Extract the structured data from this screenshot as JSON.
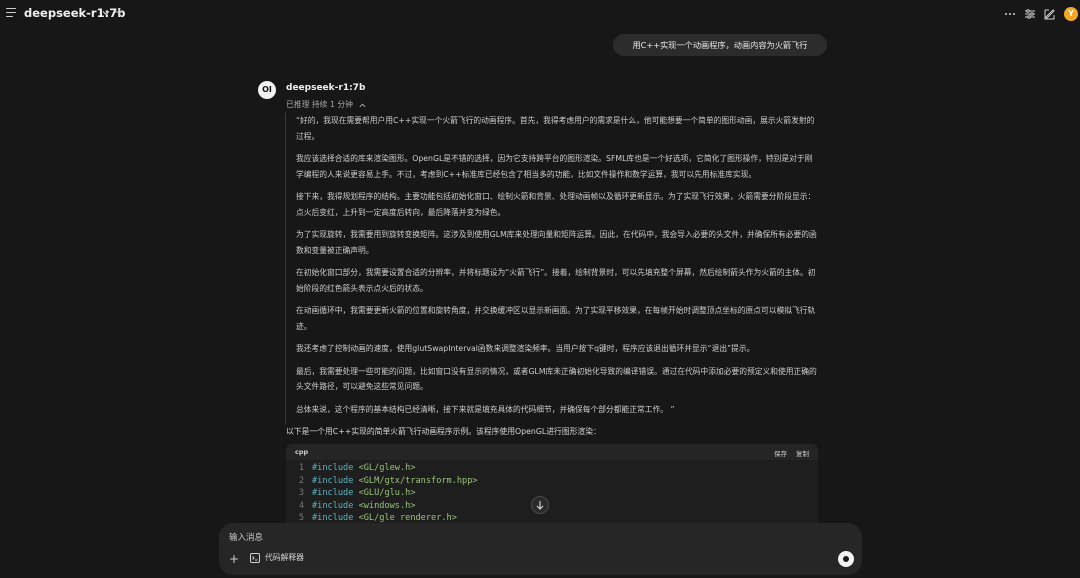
{
  "header": {
    "model_name": "deepseek-r1:7b",
    "new_chat_symbol": "+",
    "avatar_initial": "Y",
    "icons": [
      "menu-icon",
      "chevron-down-icon",
      "plus-icon",
      "more-horizontal-icon",
      "sliders-icon",
      "edit-icon"
    ]
  },
  "user_message": "用C++实现一个动画程序，动画内容为火箭飞行",
  "assistant": {
    "avatar_label": "OI",
    "name": "deepseek-r1:7b",
    "reasoning_status": "已推理 持续 1 分钟",
    "thinking": [
      "“好的，我现在需要帮用户用C++实现一个火箭飞行的动画程序。首先，我得考虑用户的需求是什么，他可能想要一个简单的图形动画，展示火箭发射的过程。",
      "我应该选择合适的库来渲染图形。OpenGL是不错的选择，因为它支持跨平台的图形渲染。SFML库也是一个好选项，它简化了图形操作，特别是对于刚学编程的人来说更容易上手。不过，考虑到C++标准库已经包含了相当多的功能，比如文件操作和数学运算，我可以先用标准库实现。",
      "接下来，我得规划程序的结构。主要功能包括初始化窗口、绘制火箭和背景、处理动画帧以及循环更新显示。为了实现飞行效果，火箭需要分阶段显示：点火后变红，上升到一定高度后转向，最后降落并变为绿色。",
      "为了实现旋转，我需要用到旋转变换矩阵。这涉及到使用GLM库来处理向量和矩阵运算。因此，在代码中，我会导入必要的头文件，并确保所有必要的函数和变量被正确声明。",
      "在初始化窗口部分，我需要设置合适的分辨率，并将标题设为“火箭飞行”。接着，绘制背景时，可以先填充整个屏幕，然后绘制箭头作为火箭的主体。初始阶段的红色箭头表示点火后的状态。",
      "在动画循环中，我需要更新火箭的位置和旋转角度，并交换缓冲区以显示新画面。为了实现平移效果，在每帧开始时调整顶点坐标的原点可以模拟飞行轨迹。",
      "我还考虑了控制动画的速度，使用glutSwapInterval函数来调整渲染频率。当用户按下q键时，程序应该退出循环并显示“退出”提示。",
      "最后，我需要处理一些可能的问题，比如窗口没有显示的情况，或者GLM库未正确初始化导致的编译错误。通过在代码中添加必要的预定义和使用正确的头文件路径，可以避免这些常见问题。",
      "总体来说，这个程序的基本结构已经清晰，接下来就是填充具体的代码细节，并确保每个部分都能正常工作。 ”"
    ],
    "intro": "以下是一个用C++实现的简单火箭飞行动画程序示例。该程序使用OpenGL进行图形渲染：",
    "code": {
      "language": "cpp",
      "save_label": "保存",
      "copy_label": "复制",
      "lines": [
        {
          "num": "1",
          "directive": "#include",
          "path": " <GL/glew.h>"
        },
        {
          "num": "2",
          "directive": "#include",
          "path": " <GLM/gtx/transform.hpp>"
        },
        {
          "num": "3",
          "directive": "#include",
          "path": " <GLU/glu.h>"
        },
        {
          "num": "4",
          "directive": "#include",
          "path": " <windows.h>"
        },
        {
          "num": "5",
          "directive": "#include",
          "path": " <GL/gle renderer.h>"
        }
      ]
    }
  },
  "input": {
    "placeholder": "输入消息",
    "add_symbol": "+",
    "code_interpreter_label": "代码解释器"
  },
  "colors": {
    "background": "#171717",
    "user_bubble": "#2c2c2c",
    "code_keyword": "#56b6c2",
    "code_string": "#98c379",
    "avatar": "#f5a623"
  }
}
